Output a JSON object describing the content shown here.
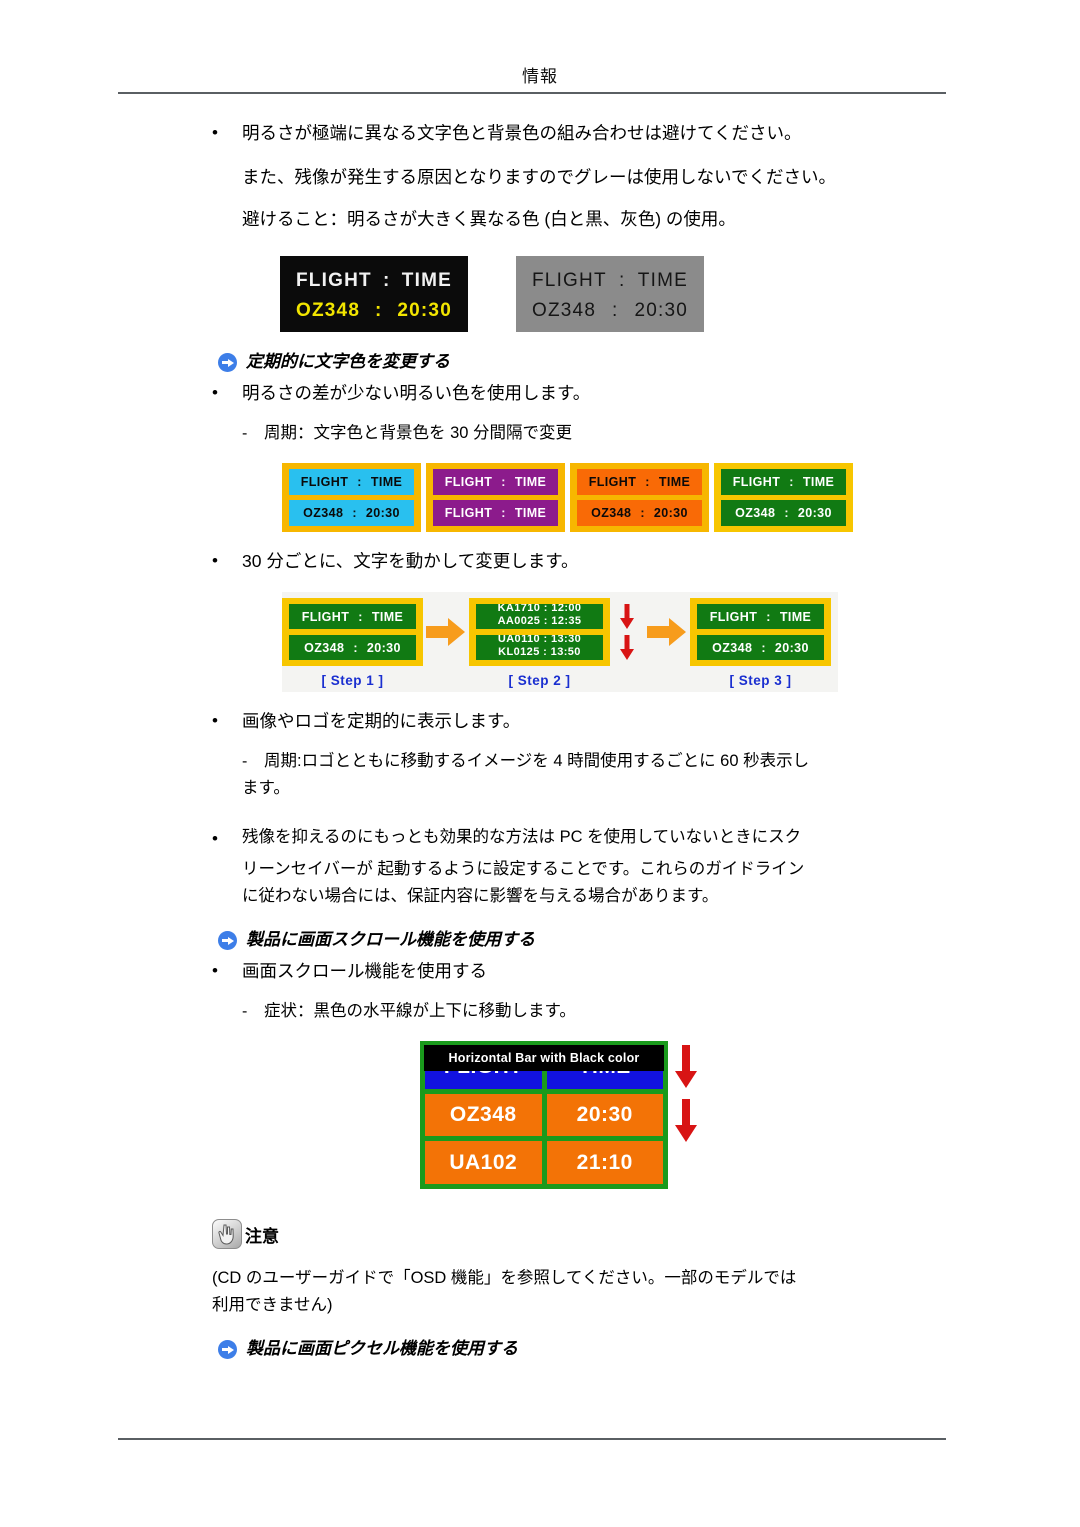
{
  "header": {
    "title": "情報"
  },
  "body": {
    "bullet_1": "明るさが極端に異なる文字色と背景色の組み合わせは避けてください。",
    "line_1b": "また、残像が発生する原因となりますのでグレーは使用しないでください。",
    "line_1c": "避けること：明るさが大きく異なる色 (白と黒、灰色) の使用。",
    "section_1_title": "定期的に文字色を変更する",
    "bullet_2": "明るさの差が少ない明るい色を使用します。",
    "dash_1": "周期：文字色と背景色を 30 分間隔で変更",
    "bullet_3": "30 分ごとに、文字を動かして変更します。",
    "bullet_4": "画像やロゴを定期的に表示します。",
    "dash_2": "周期:ロゴとともに移動するイメージを 4 時間使用するごとに 60 秒表示し",
    "dash_2_cont": "ます。",
    "bullet_5_l1": "残像を抑えるのにもっとも効果的な方法は PC を使用していないときにスク",
    "bullet_5_l2": "リーンセイバーが 起動するように設定することです。これらのガイドライン",
    "bullet_5_l3": "に従わない場合には、保証内容に影響を与える場合があります。",
    "section_2_title": "製品に画面スクロール機能を使用する",
    "bullet_6": "画面スクロール機能を使用する",
    "dash_3": "症状：黒色の水平線が上下に移動します。",
    "note_label": "注意",
    "note_text_l1": "(CD のユーザーガイドで「OSD 機能」を参照してください。一部のモデルでは",
    "note_text_l2": "利用できません)",
    "section_3_title": "製品に画面ピクセル機能を使用する"
  },
  "figure_contrast": {
    "panels": [
      {
        "style": "black",
        "row1": {
          "left": "FLIGHT",
          "sep": ":",
          "right": "TIME"
        },
        "row2": {
          "left": "OZ348",
          "sep": ":",
          "right": "20:30"
        },
        "bg": "#0b0b0b",
        "row1_color": "#f2f2f2",
        "row2_color": "#f2e500"
      },
      {
        "style": "gray",
        "row1": {
          "left": "FLIGHT",
          "sep": ":",
          "right": "TIME"
        },
        "row2": {
          "left": "OZ348",
          "sep": ":",
          "right": "20:30"
        },
        "bg": "#8b8b8b",
        "row1_color": "#151515",
        "row2_color": "#151515"
      }
    ]
  },
  "figure_colors": {
    "panels": [
      {
        "name": "cyan",
        "border": "#f7b700",
        "cell_bg": "#29c0ef",
        "text": "#0a0a0a",
        "row1": {
          "left": "FLIGHT",
          "sep": ":",
          "right": "TIME"
        },
        "row2": {
          "left": "OZ348",
          "sep": ":",
          "right": "20:30"
        }
      },
      {
        "name": "purple",
        "border": "#f7b700",
        "cell_bg": "#8c1b8c",
        "text": "#ffffff",
        "row1": {
          "left": "FLIGHT",
          "sep": ":",
          "right": "TIME"
        },
        "row2": {
          "left": "FLIGHT",
          "sep": ":",
          "right": "TIME"
        }
      },
      {
        "name": "orange",
        "border": "#f7b700",
        "cell_bg": "#f96a06",
        "text": "#0a0a0a",
        "row1": {
          "left": "FLIGHT",
          "sep": ":",
          "right": "TIME"
        },
        "row2": {
          "left": "OZ348",
          "sep": ":",
          "right": "20:30"
        }
      },
      {
        "name": "green",
        "border": "#f7c600",
        "cell_bg": "#117a13",
        "text": "#ffffff",
        "row1": {
          "left": "FLIGHT",
          "sep": ":",
          "right": "TIME"
        },
        "row2": {
          "left": "OZ348",
          "sep": ":",
          "right": "20:30"
        }
      }
    ]
  },
  "figure_steps": {
    "step1": {
      "label": "[ Step 1 ]",
      "row1": {
        "left": "FLIGHT",
        "sep": ":",
        "right": "TIME"
      },
      "row2": {
        "left": "OZ348",
        "sep": ":",
        "right": "20:30"
      }
    },
    "step2": {
      "label": "[ Step 2 ]",
      "row1_top": "KA1710 : 12:00",
      "row1_bottom": "AA0025 : 12:35",
      "row2_top": "UA0110 : 13:30",
      "row2_bottom": "KL0125 : 13:50"
    },
    "step3": {
      "label": "[ Step 3 ]",
      "row1": {
        "left": "FLIGHT",
        "sep": ":",
        "right": "TIME"
      },
      "row2": {
        "left": "OZ348",
        "sep": ":",
        "right": "20:30"
      }
    }
  },
  "figure_hbar": {
    "bar_label": "Horizontal Bar with Black color",
    "head": {
      "left": "FLIGHT",
      "right": "TIME"
    },
    "rows": [
      {
        "left": "OZ348",
        "right": "20:30"
      },
      {
        "left": "UA102",
        "right": "21:10"
      }
    ],
    "board_bg": "#1a9a1c",
    "head_bg": "#1212e0",
    "cell_bg": "#f37306",
    "arrow_color": "#d81414"
  }
}
